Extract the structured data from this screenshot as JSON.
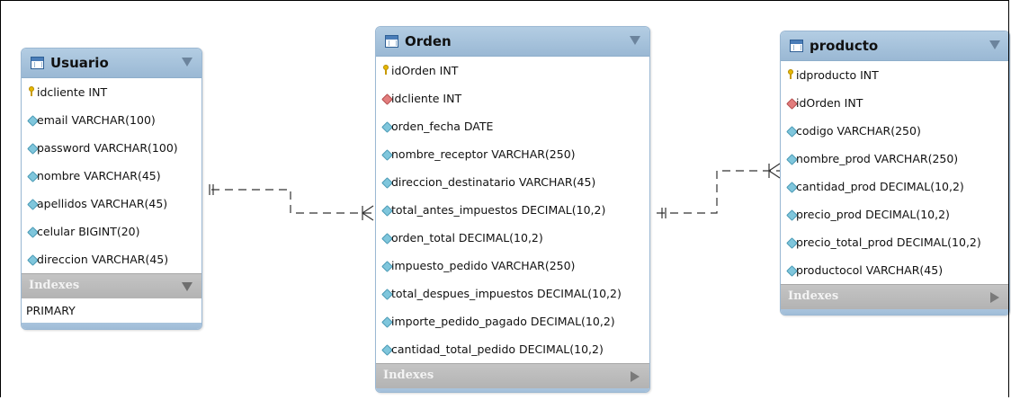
{
  "tables": {
    "usuario": {
      "name": "Usuario",
      "columns": [
        {
          "text": "idcliente INT",
          "icon": "primary-key-icon"
        },
        {
          "text": "email VARCHAR(100)",
          "icon": "attribute-diamond-icon"
        },
        {
          "text": "password VARCHAR(100)",
          "icon": "attribute-diamond-icon"
        },
        {
          "text": "nombre VARCHAR(45)",
          "icon": "attribute-diamond-icon"
        },
        {
          "text": "apellidos VARCHAR(45)",
          "icon": "attribute-diamond-icon"
        },
        {
          "text": "celular BIGINT(20)",
          "icon": "attribute-diamond-icon"
        },
        {
          "text": "direccion VARCHAR(45)",
          "icon": "attribute-diamond-icon"
        }
      ],
      "indexes_label": "Indexes",
      "indexes": [
        "PRIMARY"
      ]
    },
    "orden": {
      "name": "Orden",
      "columns": [
        {
          "text": "idOrden INT",
          "icon": "primary-key-icon"
        },
        {
          "text": "idcliente INT",
          "icon": "foreign-key-diamond-icon"
        },
        {
          "text": "orden_fecha DATE",
          "icon": "attribute-diamond-icon"
        },
        {
          "text": "nombre_receptor VARCHAR(250)",
          "icon": "attribute-diamond-icon"
        },
        {
          "text": "direccion_destinatario VARCHAR(45)",
          "icon": "attribute-diamond-icon"
        },
        {
          "text": "total_antes_impuestos DECIMAL(10,2)",
          "icon": "attribute-diamond-icon"
        },
        {
          "text": "orden_total DECIMAL(10,2)",
          "icon": "attribute-diamond-icon"
        },
        {
          "text": "impuesto_pedido VARCHAR(250)",
          "icon": "attribute-diamond-icon"
        },
        {
          "text": "total_despues_impuestos DECIMAL(10,2)",
          "icon": "attribute-diamond-icon"
        },
        {
          "text": "importe_pedido_pagado DECIMAL(10,2)",
          "icon": "attribute-diamond-icon"
        },
        {
          "text": "cantidad_total_pedido DECIMAL(10,2)",
          "icon": "attribute-diamond-icon"
        }
      ],
      "indexes_label": "Indexes"
    },
    "producto": {
      "name": "producto",
      "columns": [
        {
          "text": "idproducto INT",
          "icon": "primary-key-icon"
        },
        {
          "text": "idOrden INT",
          "icon": "foreign-key-diamond-icon"
        },
        {
          "text": "codigo VARCHAR(250)",
          "icon": "attribute-diamond-icon"
        },
        {
          "text": "nombre_prod VARCHAR(250)",
          "icon": "attribute-diamond-icon"
        },
        {
          "text": "cantidad_prod DECIMAL(10,2)",
          "icon": "attribute-diamond-icon"
        },
        {
          "text": "precio_prod DECIMAL(10,2)",
          "icon": "attribute-diamond-icon"
        },
        {
          "text": "precio_total_prod DECIMAL(10,2)",
          "icon": "attribute-diamond-icon"
        },
        {
          "text": "productocol VARCHAR(45)",
          "icon": "attribute-diamond-icon"
        }
      ],
      "indexes_label": "Indexes"
    }
  },
  "relationships": [
    {
      "from": "Usuario",
      "to": "Orden",
      "style": "one-to-many"
    },
    {
      "from": "Orden",
      "to": "producto",
      "style": "one-to-many"
    }
  ]
}
